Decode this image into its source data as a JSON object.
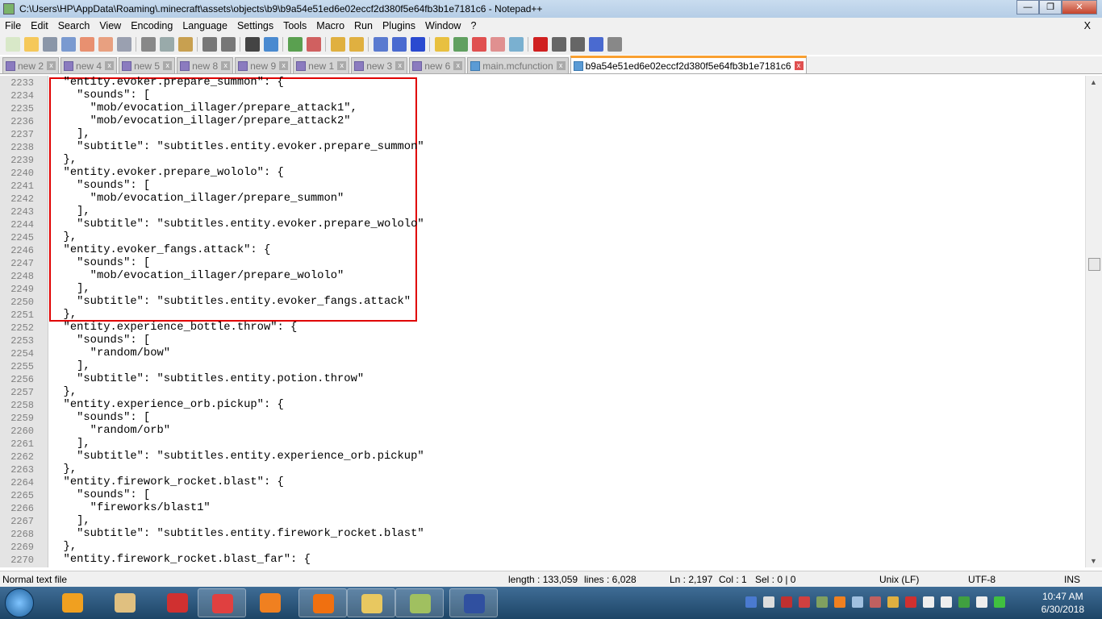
{
  "window": {
    "title": "C:\\Users\\HP\\AppData\\Roaming\\.minecraft\\assets\\objects\\b9\\b9a54e51ed6e02eccf2d380f5e64fb3b1e7181c6 - Notepad++",
    "minimize": "—",
    "maximize": "❐",
    "close": "✕"
  },
  "menu": [
    "File",
    "Edit",
    "Search",
    "View",
    "Encoding",
    "Language",
    "Settings",
    "Tools",
    "Macro",
    "Run",
    "Plugins",
    "Window",
    "?"
  ],
  "menu_close": "X",
  "toolbar": [
    "new-file",
    "open-file",
    "save",
    "save-all",
    "close",
    "close-all",
    "print",
    "cut",
    "copy",
    "paste",
    "undo",
    "redo",
    "find",
    "replace",
    "zoom-in",
    "zoom-out",
    "sync-v",
    "sync-h",
    "word-wrap",
    "all-chars",
    "indent-guide",
    "udl",
    "doc-map",
    "function-list",
    "folder-workspace",
    "monitor",
    "record-macro",
    "stop-record",
    "play-macro",
    "run-macro-multiple",
    "save-macro"
  ],
  "tabs": [
    {
      "label": "new 2",
      "icon": "purple"
    },
    {
      "label": "new 4",
      "icon": "purple"
    },
    {
      "label": "new 5",
      "icon": "purple"
    },
    {
      "label": "new 8",
      "icon": "purple"
    },
    {
      "label": "new 9",
      "icon": "purple"
    },
    {
      "label": "new 1",
      "icon": "purple"
    },
    {
      "label": "new 3",
      "icon": "purple"
    },
    {
      "label": "new 6",
      "icon": "purple"
    },
    {
      "label": "main.mcfunction",
      "icon": "blue"
    },
    {
      "label": "b9a54e51ed6e02eccf2d380f5e64fb3b1e7181c6",
      "icon": "blue",
      "active": true
    }
  ],
  "tab_close": "x",
  "editor": {
    "first_line": 2233,
    "lines": [
      "  \"entity.evoker.prepare_summon\": {",
      "    \"sounds\": [",
      "      \"mob/evocation_illager/prepare_attack1\",",
      "      \"mob/evocation_illager/prepare_attack2\"",
      "    ],",
      "    \"subtitle\": \"subtitles.entity.evoker.prepare_summon\"",
      "  },",
      "  \"entity.evoker.prepare_wololo\": {",
      "    \"sounds\": [",
      "      \"mob/evocation_illager/prepare_summon\"",
      "    ],",
      "    \"subtitle\": \"subtitles.entity.evoker.prepare_wololo\"",
      "  },",
      "  \"entity.evoker_fangs.attack\": {",
      "    \"sounds\": [",
      "      \"mob/evocation_illager/prepare_wololo\"",
      "    ],",
      "    \"subtitle\": \"subtitles.entity.evoker_fangs.attack\"",
      "  },",
      "  \"entity.experience_bottle.throw\": {",
      "    \"sounds\": [",
      "      \"random/bow\"",
      "    ],",
      "    \"subtitle\": \"subtitles.entity.potion.throw\"",
      "  },",
      "  \"entity.experience_orb.pickup\": {",
      "    \"sounds\": [",
      "      \"random/orb\"",
      "    ],",
      "    \"subtitle\": \"subtitles.entity.experience_orb.pickup\"",
      "  },",
      "  \"entity.firework_rocket.blast\": {",
      "    \"sounds\": [",
      "      \"fireworks/blast1\"",
      "    ],",
      "    \"subtitle\": \"subtitles.entity.firework_rocket.blast\"",
      "  },",
      "  \"entity.firework_rocket.blast_far\": {"
    ],
    "highlight_color": "#e00000"
  },
  "status": {
    "file_type": "Normal text file",
    "length": "length : 133,059",
    "lines": "lines : 6,028",
    "ln": "Ln : 2,197",
    "col": "Col : 1",
    "sel": "Sel : 0 | 0",
    "eol": "Unix (LF)",
    "encoding": "UTF-8",
    "mode": "INS"
  },
  "taskbar": {
    "apps": [
      "audacity",
      "paint",
      "smart-bro",
      "chrome",
      "media-player",
      "vlc",
      "file-explorer",
      "notepad-plus-plus",
      "paint-tool"
    ],
    "time": "10:47 AM",
    "date": "6/30/2018"
  }
}
